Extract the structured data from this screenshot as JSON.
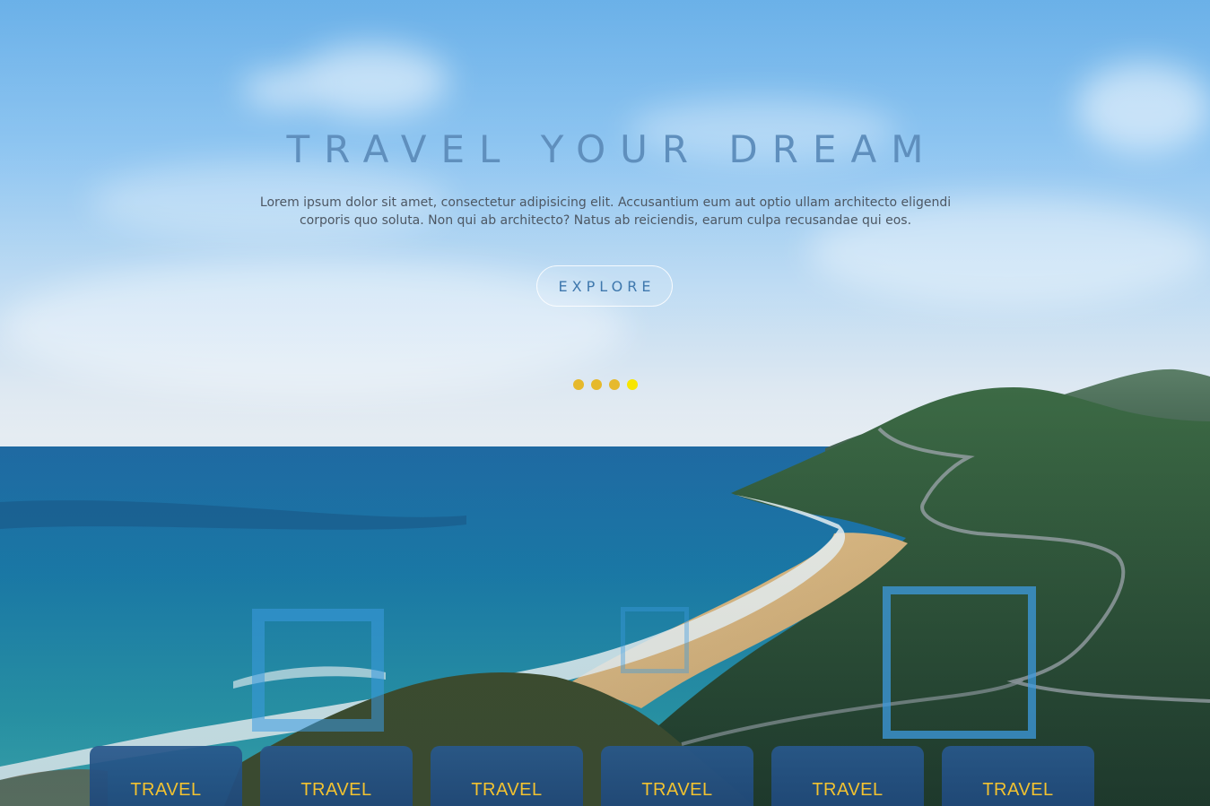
{
  "hero": {
    "title": "TRAVEL YOUR DREAM",
    "description": "Lorem ipsum dolor sit amet, consectetur adipisicing elit. Accusantium eum aut optio ullam architecto eligendi corporis quo soluta. Non qui ab architecto? Natus ab reiciendis, earum culpa recusandae qui eos.",
    "cta_label": "EXPLORE"
  },
  "slider": {
    "dot_count": 4,
    "active_index": 3,
    "dot_color": "#e6b92c",
    "active_color": "#f7e600"
  },
  "cards": [
    {
      "label": "TRAVEL"
    },
    {
      "label": "TRAVEL"
    },
    {
      "label": "TRAVEL"
    },
    {
      "label": "TRAVEL"
    },
    {
      "label": "TRAVEL"
    },
    {
      "label": "TRAVEL"
    }
  ],
  "colors": {
    "title": "#5f8fbd",
    "card_bg": "#285a8c",
    "card_text": "#f2c230",
    "square_outline": "#3d9be0"
  }
}
